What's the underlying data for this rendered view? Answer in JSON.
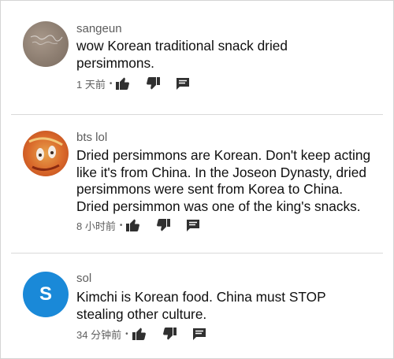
{
  "comments": [
    {
      "username": "sangeun",
      "text_lines": [
        "wow Korean traditional snack dried",
        "persimmons."
      ],
      "time": "1 天前",
      "avatar_letter": ""
    },
    {
      "username": "bts lol",
      "text_lines": [
        "Dried persimmons are Korean. Don't keep acting",
        "like it's from China. In the Joseon Dynasty, dried",
        "persimmons were sent from Korea to China.",
        "Dried persimmon was one of the king's snacks."
      ],
      "time": "8 小时前",
      "avatar_letter": ""
    },
    {
      "username": "sol",
      "text_lines": [
        "Kimchi is Korean food. China must STOP",
        "stealing other culture."
      ],
      "time": "34 分钟前",
      "avatar_letter": "S"
    }
  ],
  "icons": {
    "like": "thumb-up-icon",
    "dislike": "thumb-down-icon",
    "reply": "reply-icon"
  },
  "colors": {
    "avatar_sol": "#1a89d8",
    "text": "#0f0f0f",
    "meta": "#5f5f5f"
  }
}
